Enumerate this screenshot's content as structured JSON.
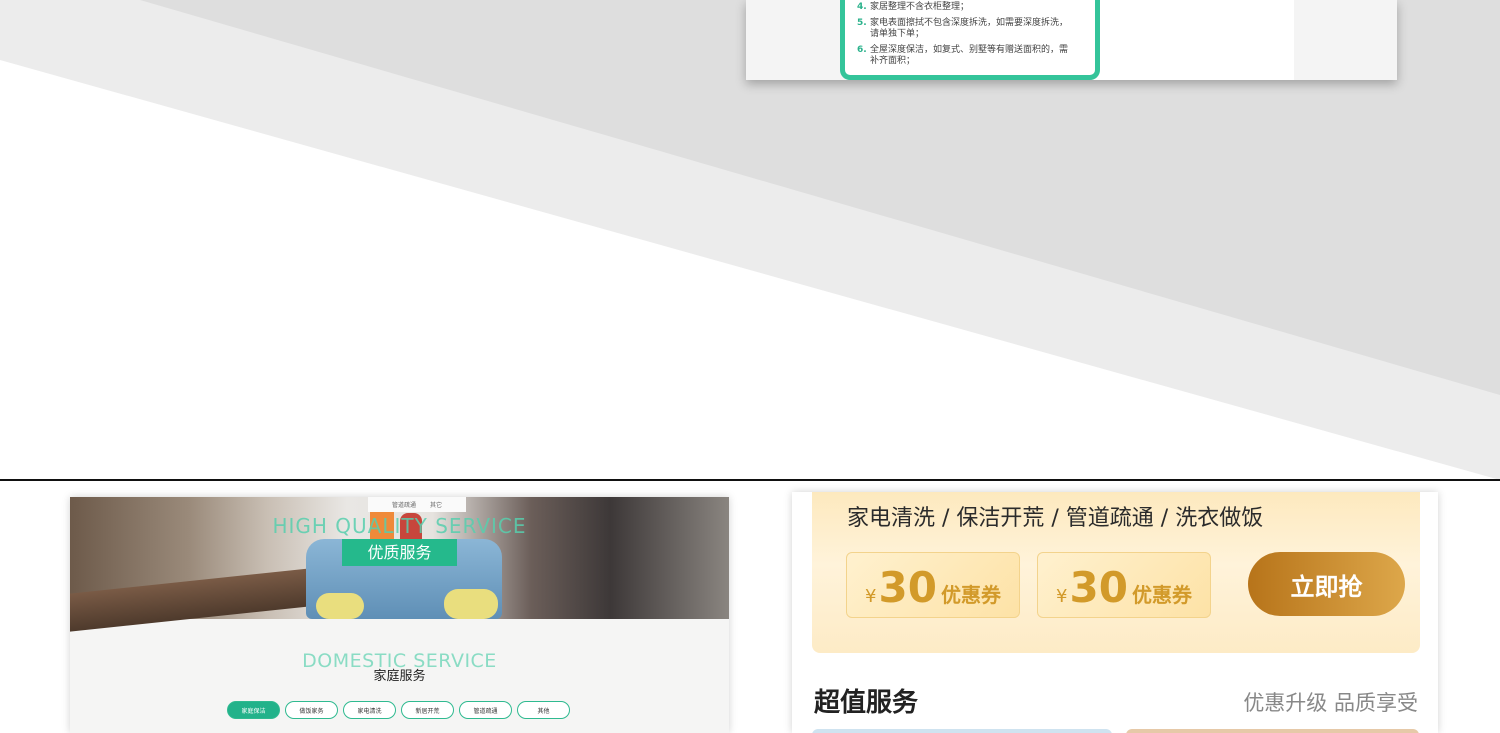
{
  "top_card": {
    "rules": [
      {
        "num": "4.",
        "text": "家居整理不含衣柜整理；"
      },
      {
        "num": "5.",
        "text": "家电表面擦拭不包含深度拆洗，如需要深度拆洗，请单独下单；"
      },
      {
        "num": "6.",
        "text": "全屋深度保洁，如复式、别墅等有赠送面积的，需补齐面积；"
      }
    ]
  },
  "left_panel": {
    "menu_items": [
      "管道疏通",
      "其它"
    ],
    "hero_english": "HIGH QUALITY SERVICE",
    "hero_badge": "优质服务",
    "section_english": "DOMESTIC SERVICE",
    "section_title": "家庭服务",
    "tabs": [
      "家庭保洁",
      "做饭家务",
      "家电清洗",
      "新居开荒",
      "管道疏通",
      "其他"
    ]
  },
  "right_panel": {
    "categories": "家电清洗 / 保洁开荒 / 管道疏通 / 洗衣做饭",
    "coupons": [
      {
        "currency": "¥",
        "amount": "30",
        "label": "优惠券"
      },
      {
        "currency": "¥",
        "amount": "30",
        "label": "优惠券"
      }
    ],
    "grab_label": "立即抢",
    "section_title": "超值服务",
    "section_subtitle": "优惠升级 品质享受"
  },
  "colors": {
    "accent_green": "#25b98c",
    "coupon_gold": "#d29a2a",
    "button_gold": "#c98a2c"
  }
}
